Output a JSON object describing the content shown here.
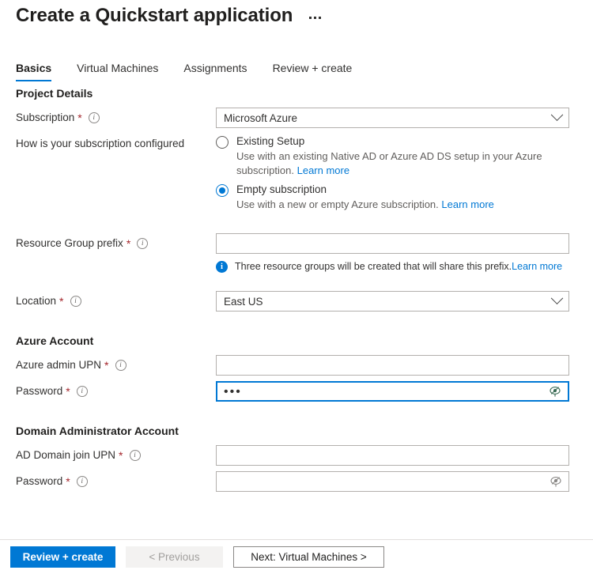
{
  "header": {
    "title": "Create a Quickstart application",
    "more_label": "More options"
  },
  "tabs": [
    {
      "label": "Basics",
      "active": true
    },
    {
      "label": "Virtual Machines",
      "active": false
    },
    {
      "label": "Assignments",
      "active": false
    },
    {
      "label": "Review + create",
      "active": false
    }
  ],
  "sections": {
    "project_details": {
      "heading": "Project Details",
      "subscription": {
        "label": "Subscription",
        "required": "*",
        "value": "Microsoft Azure"
      },
      "configured": {
        "label": "How is your subscription configured",
        "options": [
          {
            "title": "Existing Setup",
            "description": "Use with an existing Native AD or Azure AD DS setup in your Azure subscription.",
            "link": "Learn more",
            "selected": false
          },
          {
            "title": "Empty subscription",
            "description": "Use with a new or empty Azure subscription.",
            "link": "Learn more",
            "selected": true
          }
        ]
      },
      "resource_group_prefix": {
        "label": "Resource Group prefix",
        "required": "*",
        "value": "",
        "info_message": "Three resource groups will be created that will share this prefix.",
        "info_link": "Learn more"
      },
      "location": {
        "label": "Location",
        "required": "*",
        "value": "East US"
      }
    },
    "azure_account": {
      "heading": "Azure Account",
      "admin_upn": {
        "label": "Azure admin UPN",
        "required": "*",
        "value": ""
      },
      "password": {
        "label": "Password",
        "required": "*",
        "value": "•••",
        "focused": true
      }
    },
    "domain_admin": {
      "heading": "Domain Administrator Account",
      "join_upn": {
        "label": "AD Domain join UPN",
        "required": "*",
        "value": ""
      },
      "password": {
        "label": "Password",
        "required": "*",
        "value": ""
      }
    }
  },
  "footer": {
    "review_create": "Review + create",
    "previous": "< Previous",
    "next": "Next: Virtual Machines >"
  },
  "colors": {
    "accent": "#0078d4",
    "required": "#a4262c",
    "disabled_bg": "#f3f2f1"
  }
}
